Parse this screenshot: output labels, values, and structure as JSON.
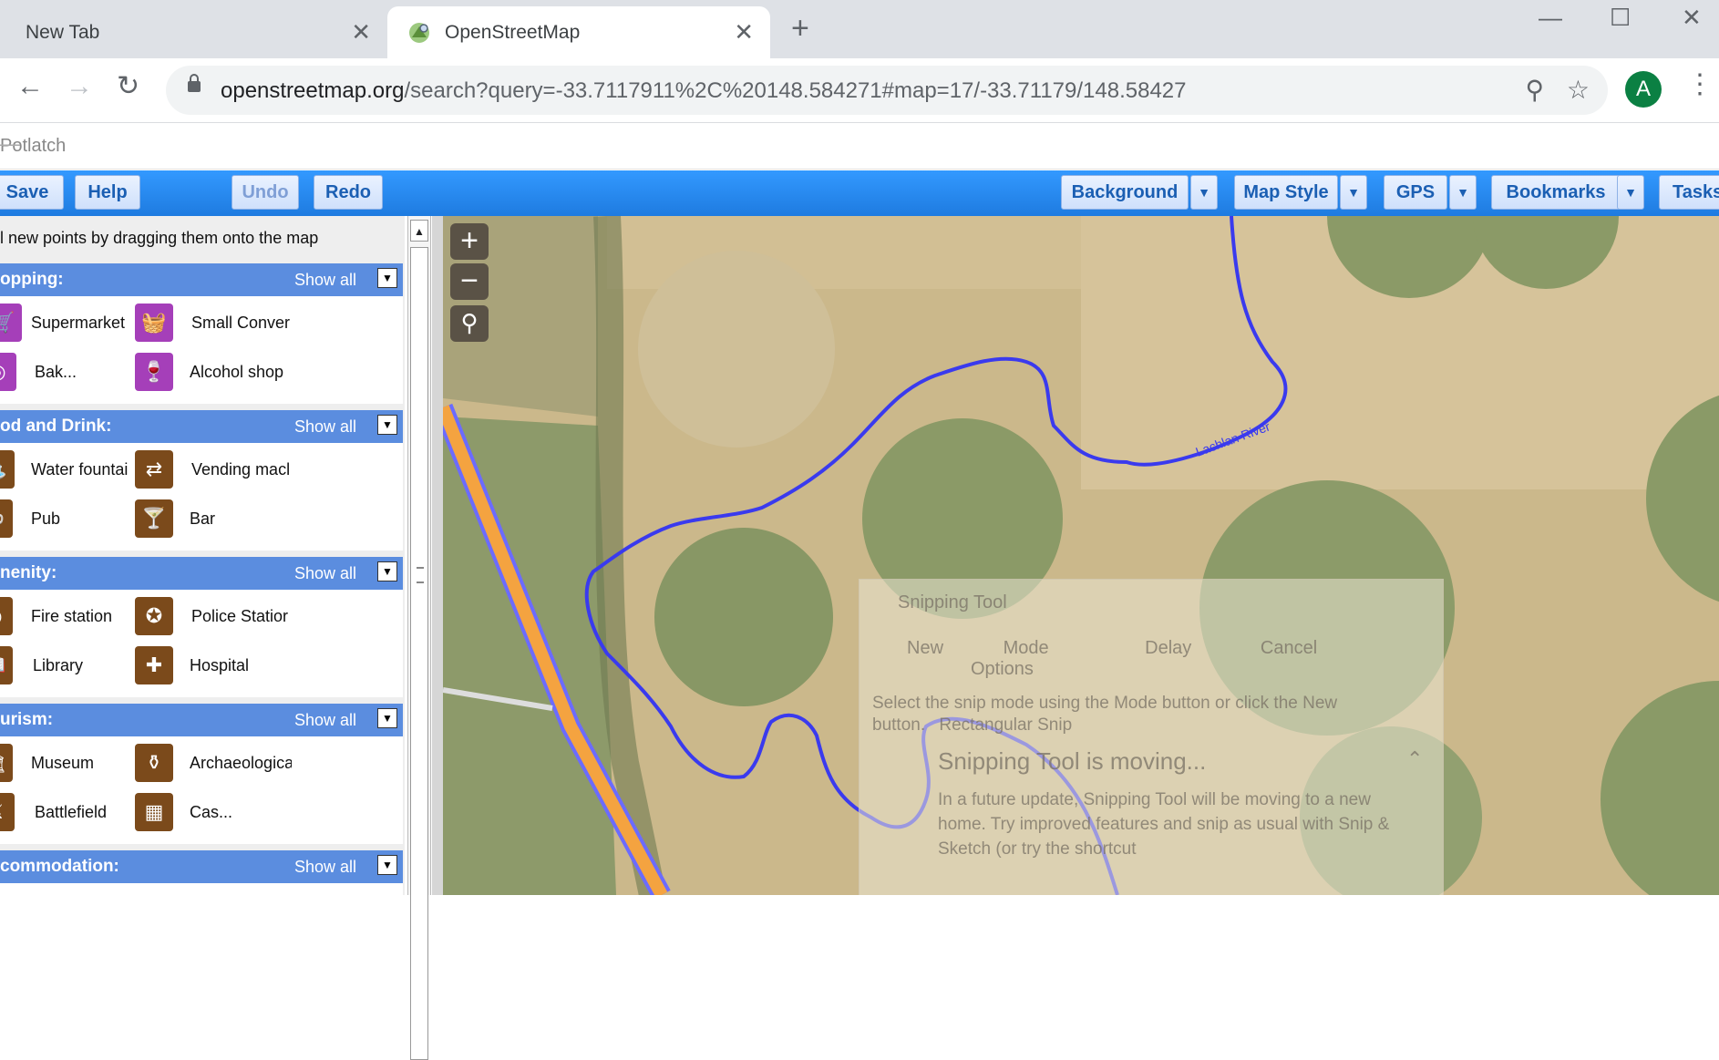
{
  "browser": {
    "tabs": [
      {
        "title": "New Tab",
        "active": false
      },
      {
        "title": "OpenStreetMap",
        "active": true
      }
    ],
    "new_tab_symbol": "+",
    "url_host": "openstreetmap.org",
    "url_path": "/search?query=-33.7117911%2C%20148.584271#map=17/-33.71179/148.58427",
    "avatar_letter": "A"
  },
  "app": {
    "window_title": "Potlatch",
    "toolbar": {
      "save": "Save",
      "help": "Help",
      "undo": "Undo",
      "redo": "Redo",
      "background": "Background",
      "map_style": "Map Style",
      "gps": "GPS",
      "bookmarks": "Bookmarks",
      "tasks": "Tasks"
    },
    "hint": "l new points by dragging them onto the map",
    "show_all": "Show all",
    "categories": [
      {
        "title": "opping:",
        "items": [
          {
            "label": "Supermarket",
            "icon": "cart-icon",
            "color": "purple"
          },
          {
            "label": "Small Conver",
            "icon": "basket-icon",
            "color": "purple"
          },
          {
            "label": "Bak...",
            "icon": "bread-icon",
            "color": "purple"
          },
          {
            "label": "Alcohol shop",
            "icon": "bottle-icon",
            "color": "purple"
          }
        ]
      },
      {
        "title": "od and Drink:",
        "items": [
          {
            "label": "Water fountai",
            "icon": "fountain-icon",
            "color": "brown"
          },
          {
            "label": "Vending macl",
            "icon": "vending-icon",
            "color": "brown"
          },
          {
            "label": "Pub",
            "icon": "pub-icon",
            "color": "brown"
          },
          {
            "label": "Bar",
            "icon": "cocktail-icon",
            "color": "brown"
          }
        ]
      },
      {
        "title": "nenity:",
        "items": [
          {
            "label": "Fire station",
            "icon": "fire-icon",
            "color": "brown"
          },
          {
            "label": "Police Statior",
            "icon": "police-icon",
            "color": "brown"
          },
          {
            "label": "Library",
            "icon": "book-icon",
            "color": "brown"
          },
          {
            "label": "Hospital",
            "icon": "hospital-icon",
            "color": "brown"
          }
        ]
      },
      {
        "title": "urism:",
        "items": [
          {
            "label": "Museum",
            "icon": "museum-icon",
            "color": "brown"
          },
          {
            "label": "Archaeologica",
            "icon": "vase-icon",
            "color": "brown"
          },
          {
            "label": "Battlefield",
            "icon": "swords-icon",
            "color": "brown"
          },
          {
            "label": "Cas...",
            "icon": "castle-icon",
            "color": "brown"
          }
        ]
      },
      {
        "title": "commodation:",
        "items": []
      }
    ]
  },
  "map": {
    "river_label": "Lachlan River",
    "snipping_tool": {
      "title": "Snipping Tool",
      "new": "New",
      "mode": "Mode",
      "delay": "Delay",
      "cancel": "Cancel",
      "options": "Options",
      "desc": "Select the snip mode using the Mode button or click the New button.",
      "mode_value": "Rectangular Snip",
      "banner": "Snipping Tool is moving...",
      "body": "In a future update, Snipping Tool will be moving to a new home. Try improved features and snip as usual with Snip & Sketch (or try the shortcut"
    }
  },
  "colors": {
    "app_bar": "#1e7be0",
    "category_header": "#5b8ddf",
    "purple_icon": "#a53fb9",
    "brown_icon": "#7b4a1b",
    "river": "#3a3aee",
    "road": "#f4a340"
  }
}
